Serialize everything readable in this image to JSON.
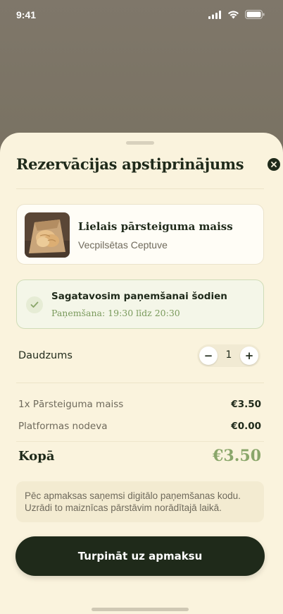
{
  "status_bar": {
    "time": "9:41"
  },
  "sheet": {
    "title": "Rezervācijas apstiprinājums",
    "close_icon": "close-icon"
  },
  "product": {
    "name": "Lielais pārsteiguma maiss",
    "store": "Vecpilsētas Ceptuve"
  },
  "pickup": {
    "title": "Sagatavosim paņemšanai šodien",
    "time": "Paņemšana: 19:30 līdz 20:30"
  },
  "quantity": {
    "label": "Daudzums",
    "value": "1",
    "decrement": "−",
    "increment": "+"
  },
  "summary": {
    "lines": [
      {
        "label": "1x Pārsteiguma maiss",
        "value": "€3.50"
      },
      {
        "label": "Platformas nodeva",
        "value": "€0.00"
      }
    ],
    "total_label": "Kopā",
    "total_value": "€3.50"
  },
  "info": {
    "line1": "Pēc apmaksas saņemsi digitālo paņemšanas kodu.",
    "line2": "Uzrādi to maiznīcas pārstāvim norādītajā laikā."
  },
  "cta": {
    "label": "Turpināt uz apmaksu"
  },
  "colors": {
    "accent_dark": "#1f2a1a",
    "accent_green": "#8aa66a",
    "sheet_bg": "#faf3dd"
  }
}
